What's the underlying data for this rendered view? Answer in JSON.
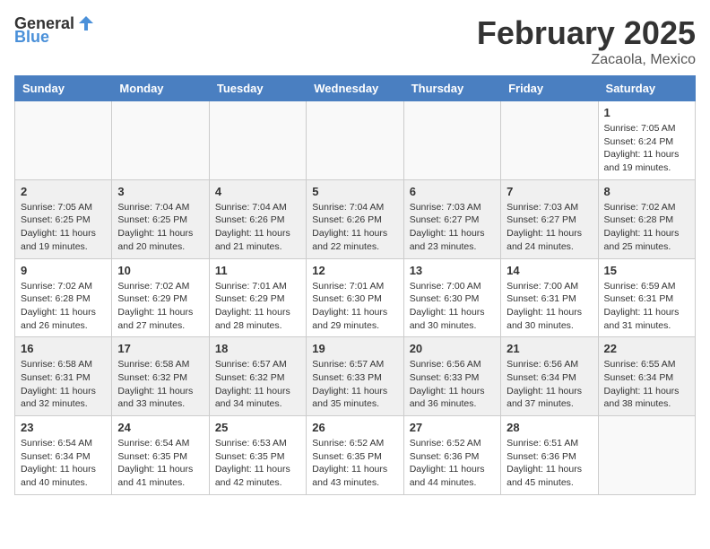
{
  "app": {
    "logo_general": "General",
    "logo_blue": "Blue"
  },
  "header": {
    "month_year": "February 2025",
    "location": "Zacaola, Mexico"
  },
  "weekdays": [
    "Sunday",
    "Monday",
    "Tuesday",
    "Wednesday",
    "Thursday",
    "Friday",
    "Saturday"
  ],
  "weeks": [
    [
      {
        "day": "",
        "info": ""
      },
      {
        "day": "",
        "info": ""
      },
      {
        "day": "",
        "info": ""
      },
      {
        "day": "",
        "info": ""
      },
      {
        "day": "",
        "info": ""
      },
      {
        "day": "",
        "info": ""
      },
      {
        "day": "1",
        "info": "Sunrise: 7:05 AM\nSunset: 6:24 PM\nDaylight: 11 hours and 19 minutes."
      }
    ],
    [
      {
        "day": "2",
        "info": "Sunrise: 7:05 AM\nSunset: 6:25 PM\nDaylight: 11 hours and 19 minutes."
      },
      {
        "day": "3",
        "info": "Sunrise: 7:04 AM\nSunset: 6:25 PM\nDaylight: 11 hours and 20 minutes."
      },
      {
        "day": "4",
        "info": "Sunrise: 7:04 AM\nSunset: 6:26 PM\nDaylight: 11 hours and 21 minutes."
      },
      {
        "day": "5",
        "info": "Sunrise: 7:04 AM\nSunset: 6:26 PM\nDaylight: 11 hours and 22 minutes."
      },
      {
        "day": "6",
        "info": "Sunrise: 7:03 AM\nSunset: 6:27 PM\nDaylight: 11 hours and 23 minutes."
      },
      {
        "day": "7",
        "info": "Sunrise: 7:03 AM\nSunset: 6:27 PM\nDaylight: 11 hours and 24 minutes."
      },
      {
        "day": "8",
        "info": "Sunrise: 7:02 AM\nSunset: 6:28 PM\nDaylight: 11 hours and 25 minutes."
      }
    ],
    [
      {
        "day": "9",
        "info": "Sunrise: 7:02 AM\nSunset: 6:28 PM\nDaylight: 11 hours and 26 minutes."
      },
      {
        "day": "10",
        "info": "Sunrise: 7:02 AM\nSunset: 6:29 PM\nDaylight: 11 hours and 27 minutes."
      },
      {
        "day": "11",
        "info": "Sunrise: 7:01 AM\nSunset: 6:29 PM\nDaylight: 11 hours and 28 minutes."
      },
      {
        "day": "12",
        "info": "Sunrise: 7:01 AM\nSunset: 6:30 PM\nDaylight: 11 hours and 29 minutes."
      },
      {
        "day": "13",
        "info": "Sunrise: 7:00 AM\nSunset: 6:30 PM\nDaylight: 11 hours and 30 minutes."
      },
      {
        "day": "14",
        "info": "Sunrise: 7:00 AM\nSunset: 6:31 PM\nDaylight: 11 hours and 30 minutes."
      },
      {
        "day": "15",
        "info": "Sunrise: 6:59 AM\nSunset: 6:31 PM\nDaylight: 11 hours and 31 minutes."
      }
    ],
    [
      {
        "day": "16",
        "info": "Sunrise: 6:58 AM\nSunset: 6:31 PM\nDaylight: 11 hours and 32 minutes."
      },
      {
        "day": "17",
        "info": "Sunrise: 6:58 AM\nSunset: 6:32 PM\nDaylight: 11 hours and 33 minutes."
      },
      {
        "day": "18",
        "info": "Sunrise: 6:57 AM\nSunset: 6:32 PM\nDaylight: 11 hours and 34 minutes."
      },
      {
        "day": "19",
        "info": "Sunrise: 6:57 AM\nSunset: 6:33 PM\nDaylight: 11 hours and 35 minutes."
      },
      {
        "day": "20",
        "info": "Sunrise: 6:56 AM\nSunset: 6:33 PM\nDaylight: 11 hours and 36 minutes."
      },
      {
        "day": "21",
        "info": "Sunrise: 6:56 AM\nSunset: 6:34 PM\nDaylight: 11 hours and 37 minutes."
      },
      {
        "day": "22",
        "info": "Sunrise: 6:55 AM\nSunset: 6:34 PM\nDaylight: 11 hours and 38 minutes."
      }
    ],
    [
      {
        "day": "23",
        "info": "Sunrise: 6:54 AM\nSunset: 6:34 PM\nDaylight: 11 hours and 40 minutes."
      },
      {
        "day": "24",
        "info": "Sunrise: 6:54 AM\nSunset: 6:35 PM\nDaylight: 11 hours and 41 minutes."
      },
      {
        "day": "25",
        "info": "Sunrise: 6:53 AM\nSunset: 6:35 PM\nDaylight: 11 hours and 42 minutes."
      },
      {
        "day": "26",
        "info": "Sunrise: 6:52 AM\nSunset: 6:35 PM\nDaylight: 11 hours and 43 minutes."
      },
      {
        "day": "27",
        "info": "Sunrise: 6:52 AM\nSunset: 6:36 PM\nDaylight: 11 hours and 44 minutes."
      },
      {
        "day": "28",
        "info": "Sunrise: 6:51 AM\nSunset: 6:36 PM\nDaylight: 11 hours and 45 minutes."
      },
      {
        "day": "",
        "info": ""
      }
    ]
  ]
}
